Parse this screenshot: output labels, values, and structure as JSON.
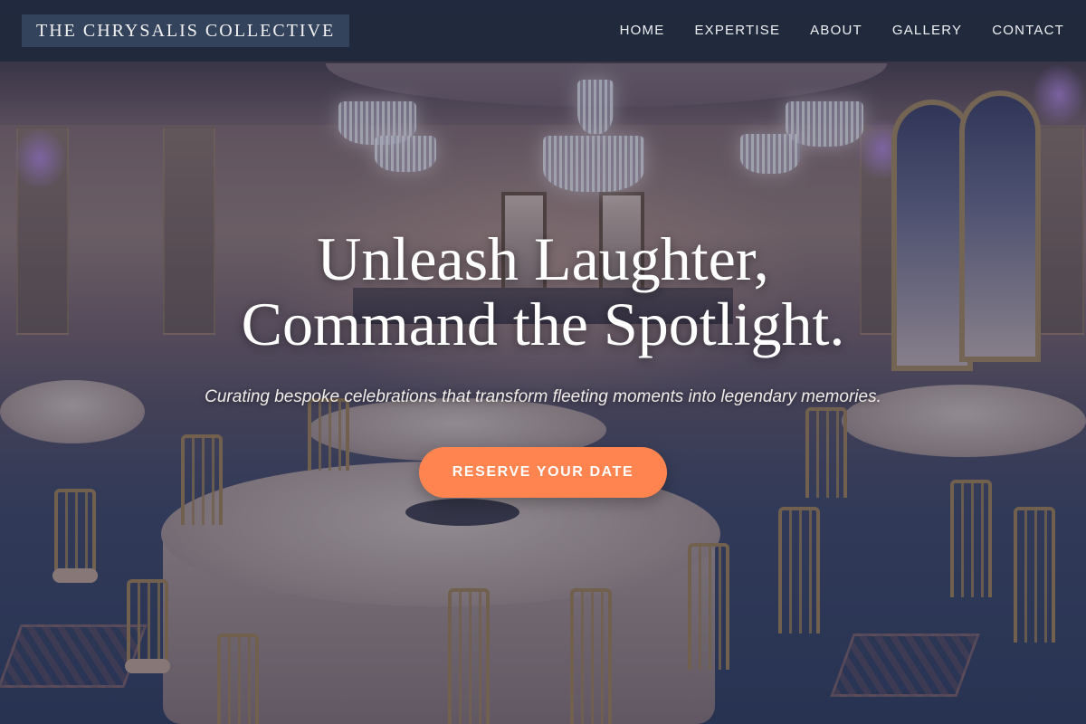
{
  "header": {
    "brand": "THE CHRYSALIS COLLECTIVE",
    "nav": [
      {
        "label": "HOME"
      },
      {
        "label": "EXPERTISE"
      },
      {
        "label": "ABOUT"
      },
      {
        "label": "GALLERY"
      },
      {
        "label": "CONTACT"
      }
    ]
  },
  "hero": {
    "title_line1": "Unleash Laughter,",
    "title_line2": "Command the Spotlight.",
    "subtitle": "Curating bespoke celebrations that transform fleeting moments into legendary memories.",
    "cta_label": "RESERVE YOUR DATE"
  },
  "colors": {
    "navbar": "#1f293c",
    "brand_box": "#33435c",
    "accent": "#ff8450",
    "overlay": "#1e2846"
  }
}
